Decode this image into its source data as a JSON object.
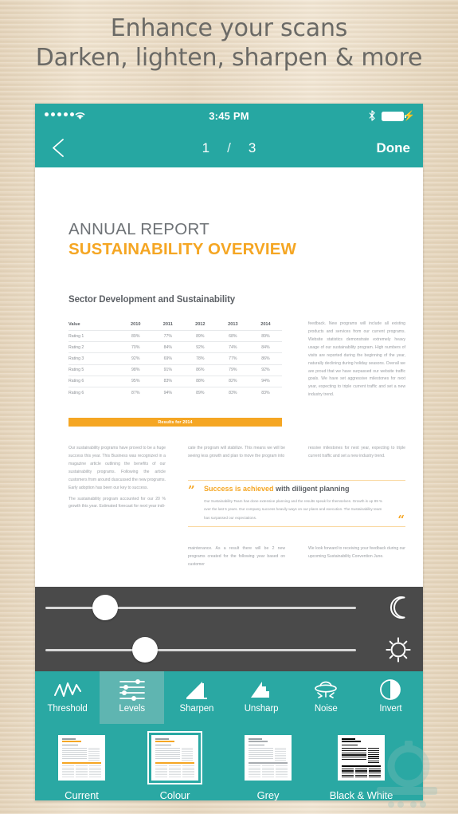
{
  "promo": {
    "line1": "Enhance your scans",
    "line2": "Darken, lighten, sharpen & more",
    "text_color": "#6b6a66",
    "background_color": "#e9dac4"
  },
  "theme": {
    "teal": "#2aa8a3",
    "teal_active": "#5fb5b1",
    "orange": "#f5a623",
    "slider_panel": "#4a4a4a"
  },
  "status_bar": {
    "signal_dots": 5,
    "wifi_icon": "wifi-icon",
    "time": "3:45 PM",
    "bluetooth_icon": "bluetooth-icon",
    "battery_icon": "battery-full-icon",
    "charging_icon": "lightning-bolt-icon"
  },
  "nav_bar": {
    "back_icon": "chevron-left-icon",
    "current_page": "1",
    "separator": "/",
    "total_pages": "3",
    "done_label": "Done"
  },
  "document": {
    "title_line1": "ANNUAL REPORT",
    "title_line2": "SUSTAINABILITY OVERVIEW",
    "section_heading": "Sector Development and Sustainability",
    "table": {
      "headers": [
        "Value",
        "2010",
        "2011",
        "2012",
        "2013",
        "2014"
      ],
      "rows": [
        [
          "Rating 1",
          "89%",
          "77%",
          "89%",
          "68%",
          "89%"
        ],
        [
          "Rating 2",
          "70%",
          "84%",
          "92%",
          "74%",
          "84%"
        ],
        [
          "Rating 3",
          "92%",
          "69%",
          "78%",
          "77%",
          "86%"
        ],
        [
          "Rating 5",
          "98%",
          "91%",
          "86%",
          "79%",
          "92%"
        ],
        [
          "Rating 6",
          "95%",
          "83%",
          "88%",
          "82%",
          "94%"
        ],
        [
          "Rating 6",
          "87%",
          "94%",
          "89%",
          "83%",
          "83%"
        ]
      ],
      "footer_bar": "Results for 2014"
    },
    "column_right_top": "feedback. New programs will include all existing products and services from our current programs. Website statistics demonstrate extremely heavy usage of our sustainability program. High numbers of visits are reported during the beginning of the year, naturally declining during holiday seasons. Overall we are proud that we have surpassed our website traffic goals. We have set aggressive milestones for next year, expecting to triple current traffic and set a new industry trend.",
    "column_a": "Our sustainability programs have proved to be a huge success this year. This Business was recognized in a magazine article outlining the benefits of our sustainability programs. Following the article customers from around duscussed the new programs. Early adoption has been our key to success.",
    "column_a2": "The sustainability program accounted for our 20 % growth this year. Estimated forecast for next year indi-",
    "column_b": "cate the program will stabilize. This means we will be seeing less growth and plan to move the program into",
    "column_c": "ressive milestones for next year, expecting to triple current traffic and set a new industry trend.",
    "column_d": "maintenance. As a result there will be 2 new programs created for the following year based on customer",
    "column_e": "We look forward to receiving your feedback during our upcoming Sustainability Convention June.",
    "quote": {
      "open_mark": "quote-open-icon",
      "close_mark": "quote-close-icon",
      "headline_highlight": "Success is achieved",
      "headline_rest": " with diligent planning",
      "body": "Our Sustainability Team has done extensive planning and the results speak for themselves. Growth is up 89 % over the last 5 years. Our company success heavily ways on our plans and execution. The Sustainability team has surpassed our expectations."
    }
  },
  "sliders": [
    {
      "name": "brightness-dark-slider",
      "icon": "moon-icon",
      "value_percent": 22
    },
    {
      "name": "brightness-light-slider",
      "icon": "sun-icon",
      "value_percent": 35
    }
  ],
  "tools": [
    {
      "label": "Threshold",
      "icon": "threshold-zigzag-icon",
      "active": false
    },
    {
      "label": "Levels",
      "icon": "levels-sliders-icon",
      "active": true
    },
    {
      "label": "Sharpen",
      "icon": "sharpen-triangle-icon",
      "active": false
    },
    {
      "label": "Unsharp",
      "icon": "unsharp-triangle-icon",
      "active": false
    },
    {
      "label": "Noise",
      "icon": "noise-ufo-icon",
      "active": false
    },
    {
      "label": "Invert",
      "icon": "invert-contrast-icon",
      "active": false
    }
  ],
  "filters": [
    {
      "label": "Current",
      "selected": false,
      "style": "colour"
    },
    {
      "label": "Colour",
      "selected": true,
      "style": "colour"
    },
    {
      "label": "Grey",
      "selected": false,
      "style": "grey"
    },
    {
      "label": "Black & White",
      "selected": false,
      "style": "bw"
    }
  ]
}
